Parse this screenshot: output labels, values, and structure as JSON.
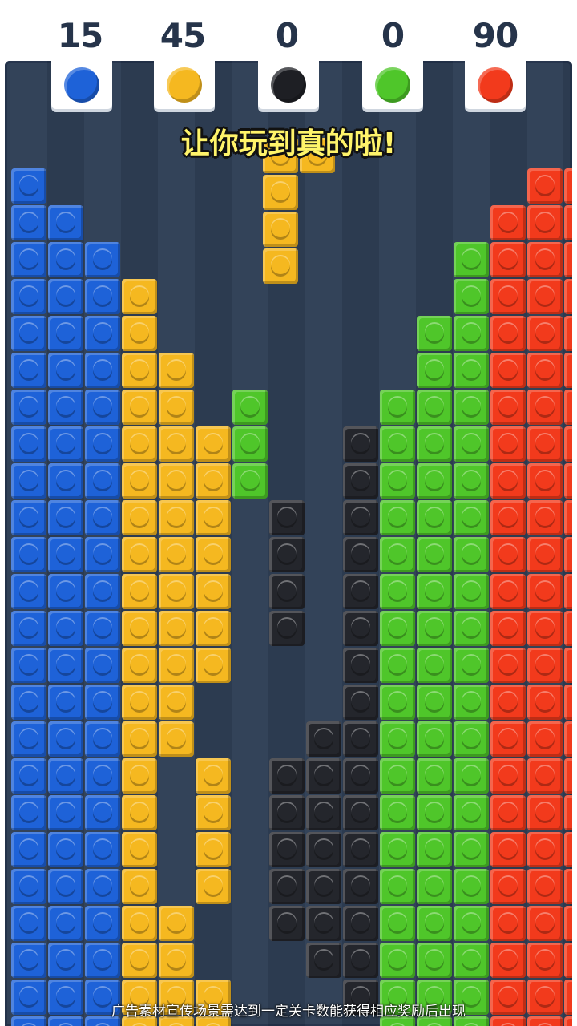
{
  "score_slots": [
    {
      "score": "15",
      "color": "#1e62d8",
      "icon": "blue-circle-icon"
    },
    {
      "score": "45",
      "color": "#f5b820",
      "icon": "yellow-circle-icon"
    },
    {
      "score": "0",
      "color": "#1e1f24",
      "icon": "black-circle-icon"
    },
    {
      "score": "0",
      "color": "#4fc62a",
      "icon": "green-circle-icon"
    },
    {
      "score": "90",
      "color": "#f23a1c",
      "icon": "red-circle-icon"
    }
  ],
  "caption": "让你玩到真的啦!",
  "ad_notice": "广告素材宣传场景需达到一定关卡数能获得相应奖励后出现",
  "colors": {
    "blue": "#1e62d8",
    "yellow": "#f5b820",
    "black": "#24262c",
    "green": "#4fc62a",
    "red": "#f23a1c",
    "board": "#2f3f55"
  },
  "columns": [
    {
      "color": "blue",
      "runs": [
        [
          0,
          23
        ]
      ]
    },
    {
      "color": "blue",
      "runs": [
        [
          1,
          23
        ]
      ]
    },
    {
      "color": "blue",
      "runs": [
        [
          2,
          23
        ]
      ]
    },
    {
      "color": "yellow",
      "runs": [
        [
          3,
          23
        ]
      ]
    },
    {
      "color": "yellow",
      "runs": [
        [
          5,
          15
        ],
        [
          20,
          23
        ]
      ]
    },
    {
      "color": "yellow",
      "runs": [
        [
          7,
          13
        ],
        [
          16,
          19
        ],
        [
          22,
          23
        ]
      ]
    },
    {
      "color": "green",
      "runs": [
        [
          6,
          8
        ]
      ]
    },
    {
      "color": "black",
      "runs": [
        [
          9,
          12
        ],
        [
          16,
          20
        ]
      ]
    },
    {
      "color": "black",
      "runs": [
        [
          15,
          21
        ]
      ]
    },
    {
      "color": "black",
      "runs": [
        [
          7,
          22
        ]
      ]
    },
    {
      "color": "green",
      "runs": [
        [
          6,
          23
        ]
      ]
    },
    {
      "color": "green",
      "runs": [
        [
          4,
          23
        ]
      ]
    },
    {
      "color": "green",
      "runs": [
        [
          2,
          23
        ]
      ]
    },
    {
      "color": "red",
      "runs": [
        [
          1,
          23
        ]
      ]
    },
    {
      "color": "red",
      "runs": [
        [
          0,
          23
        ]
      ]
    },
    {
      "color": "red",
      "runs": [
        [
          0,
          23
        ]
      ]
    }
  ],
  "falling_piece": {
    "color": "yellow",
    "cells": [
      [
        7,
        0
      ],
      [
        8,
        0
      ],
      [
        7,
        1
      ],
      [
        7,
        2
      ],
      [
        7,
        3
      ]
    ]
  }
}
